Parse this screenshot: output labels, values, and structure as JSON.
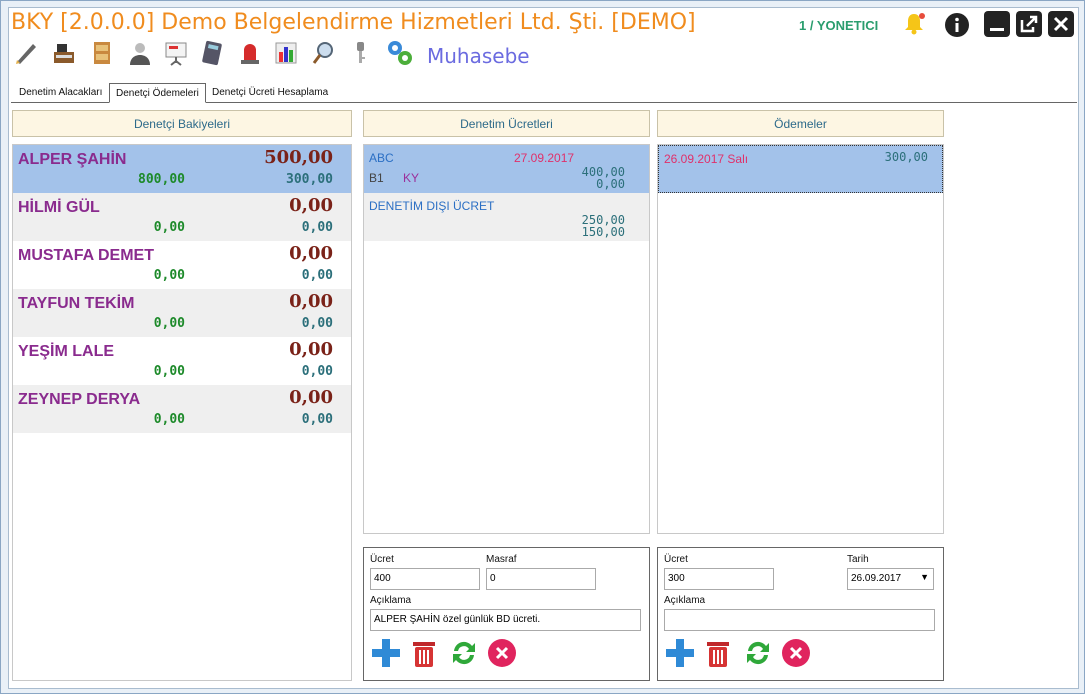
{
  "app": {
    "title": "BKY [2.0.0.0] Demo Belgelendirme Hizmetleri Ltd. Şti. [DEMO]",
    "user": "1 / YONETICI",
    "module": "Muhasebe"
  },
  "toolbar": {
    "icons": [
      "pen-icon",
      "cash-register-icon",
      "file-cabinet-icon",
      "person-icon",
      "presentation-icon",
      "calculator-icon",
      "siren-icon",
      "bar-chart-icon",
      "magnifier-icon",
      "key-icon",
      "gears-icon"
    ]
  },
  "tabs": [
    {
      "label": "Denetim Alacakları"
    },
    {
      "label": "Denetçi Ödemeleri"
    },
    {
      "label": "Denetçi Ücreti Hesaplama"
    }
  ],
  "panels": {
    "balances": "Denetçi Bakiyeleri",
    "fees": "Denetim Ücretleri",
    "payments": "Ödemeler"
  },
  "balances": [
    {
      "name": "ALPER ŞAHİN",
      "balance": "500,00",
      "left": "800,00",
      "right": "300,00"
    },
    {
      "name": "HİLMİ GÜL",
      "balance": "0,00",
      "left": "0,00",
      "right": "0,00"
    },
    {
      "name": "MUSTAFA DEMET",
      "balance": "0,00",
      "left": "0,00",
      "right": "0,00"
    },
    {
      "name": "TAYFUN TEKİM",
      "balance": "0,00",
      "left": "0,00",
      "right": "0,00"
    },
    {
      "name": "YEŞİM LALE",
      "balance": "0,00",
      "left": "0,00",
      "right": "0,00"
    },
    {
      "name": "ZEYNEP DERYA",
      "balance": "0,00",
      "left": "0,00",
      "right": "0,00"
    }
  ],
  "fees": [
    {
      "name": "ABC",
      "date": "27.09.2017",
      "code": "B1",
      "type": "KY",
      "v1": "400,00",
      "v2": "0,00"
    },
    {
      "name": "DENETİM DIŞI ÜCRET",
      "v1": "250,00",
      "v2": "150,00"
    }
  ],
  "payments": [
    {
      "date": "26.09.2017 Salı",
      "amount": "300,00"
    }
  ],
  "fee_form": {
    "ucret_label": "Ücret",
    "ucret": "400",
    "masraf_label": "Masraf",
    "masraf": "0",
    "aciklama_label": "Açıklama",
    "aciklama": "ALPER ŞAHİN özel günlük BD ücreti."
  },
  "pay_form": {
    "ucret_label": "Ücret",
    "ucret": "300",
    "tarih_label": "Tarih",
    "tarih": "26.09.2017",
    "aciklama_label": "Açıklama",
    "aciklama": ""
  },
  "colors": {
    "selected": "#a3c2ea",
    "alt": "#efefef",
    "accent": "#f08c1e"
  }
}
